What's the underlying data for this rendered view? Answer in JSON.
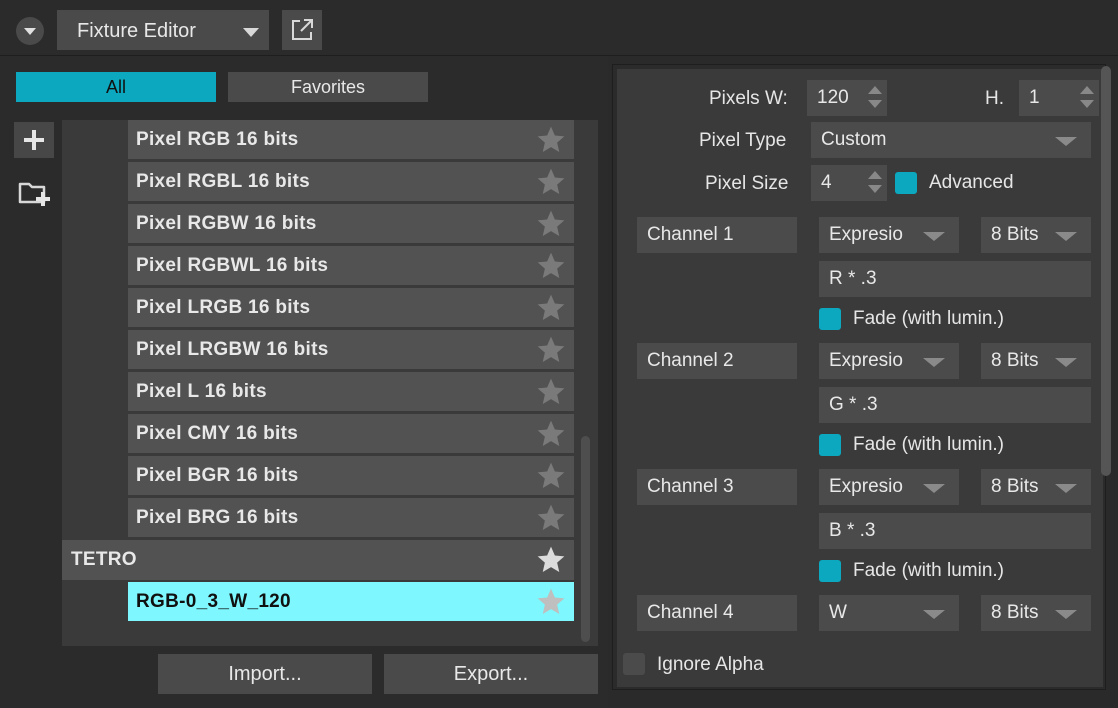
{
  "topbar": {
    "editor_title": "Fixture Editor"
  },
  "tabs": {
    "all": "All",
    "favorites": "Favorites"
  },
  "fixtures": {
    "items": [
      {
        "label": "Pixel RGB 16 bits"
      },
      {
        "label": "Pixel RGBL 16 bits"
      },
      {
        "label": "Pixel RGBW 16 bits"
      },
      {
        "label": "Pixel RGBWL 16 bits"
      },
      {
        "label": "Pixel LRGB 16 bits"
      },
      {
        "label": "Pixel LRGBW 16 bits"
      },
      {
        "label": "Pixel L 16 bits"
      },
      {
        "label": "Pixel CMY 16 bits"
      },
      {
        "label": "Pixel BGR 16 bits"
      },
      {
        "label": "Pixel BRG 16 bits"
      }
    ],
    "group": "TETRO",
    "selected": "RGB-0_3_W_120"
  },
  "buttons": {
    "import": "Import...",
    "export": "Export..."
  },
  "properties": {
    "pixels_w_label": "Pixels W:",
    "pixels_w_value": "120",
    "h_label": "H.",
    "h_value": "1",
    "pixel_type_label": "Pixel Type",
    "pixel_type_value": "Custom",
    "pixel_size_label": "Pixel Size",
    "pixel_size_value": "4",
    "advanced_label": "Advanced",
    "advanced_checked": true,
    "channels": [
      {
        "name": "Channel 1",
        "mode": "Expresio",
        "bits": "8 Bits",
        "expression": "R * .3",
        "fade_label": "Fade (with lumin.)",
        "fade_checked": true
      },
      {
        "name": "Channel 2",
        "mode": "Expresio",
        "bits": "8 Bits",
        "expression": "G * .3",
        "fade_label": "Fade (with lumin.)",
        "fade_checked": true
      },
      {
        "name": "Channel 3",
        "mode": "Expresio",
        "bits": "8 Bits",
        "expression": "B * .3",
        "fade_label": "Fade (with lumin.)",
        "fade_checked": true
      },
      {
        "name": "Channel 4",
        "mode": "W",
        "bits": "8 Bits"
      }
    ],
    "ignore_alpha_label": "Ignore Alpha",
    "ignore_alpha_checked": false
  },
  "colors": {
    "accent": "#0ba8bf",
    "selected_row": "#7ef8fe"
  }
}
